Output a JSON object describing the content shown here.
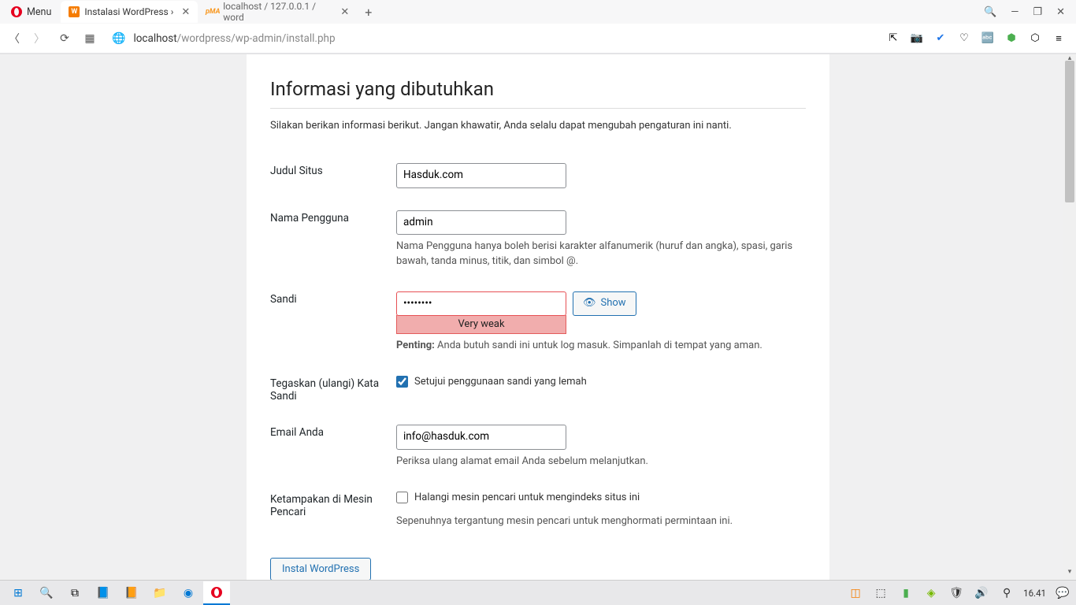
{
  "browser": {
    "menu_label": "Menu",
    "tabs": [
      {
        "title": "Instalasi WordPress ›",
        "active": true,
        "icon": "wp"
      },
      {
        "title": "localhost / 127.0.0.1 / word",
        "active": false,
        "icon": "pma"
      }
    ],
    "url_host": "localhost",
    "url_path": "/wordpress/wp-admin/install.php"
  },
  "page": {
    "heading": "Informasi yang dibutuhkan",
    "intro": "Silakan berikan informasi berikut. Jangan khawatir, Anda selalu dapat mengubah pengaturan ini nanti.",
    "site_title_label": "Judul Situs",
    "site_title_value": "Hasduk.com",
    "username_label": "Nama Pengguna",
    "username_value": "admin",
    "username_desc": "Nama Pengguna hanya boleh berisi karakter alfanumerik (huruf dan angka), spasi, garis bawah, tanda minus, titik, dan simbol @.",
    "password_label": "Sandi",
    "password_value": "••••••••",
    "show_label": "Show",
    "pw_strength": "Very weak",
    "pw_important_label": "Penting:",
    "pw_important_text": " Anda butuh sandi ini untuk log masuk. Simpanlah di tempat yang aman.",
    "confirm_label": "Tegaskan (ulangi) Kata Sandi",
    "confirm_checkbox_label": "Setujui penggunaan sandi yang lemah",
    "confirm_checked": true,
    "email_label": "Email Anda",
    "email_value": "info@hasduk.com",
    "email_desc": "Periksa ulang alamat email Anda sebelum melanjutkan.",
    "privacy_label": "Ketampakan di Mesin Pencari",
    "privacy_checkbox_label": "Halangi mesin pencari untuk mengindeks situs ini",
    "privacy_checked": false,
    "privacy_desc": "Sepenuhnya tergantung mesin pencari untuk menghormati permintaan ini.",
    "submit_label": "Instal WordPress"
  },
  "taskbar": {
    "time": "16.41"
  }
}
